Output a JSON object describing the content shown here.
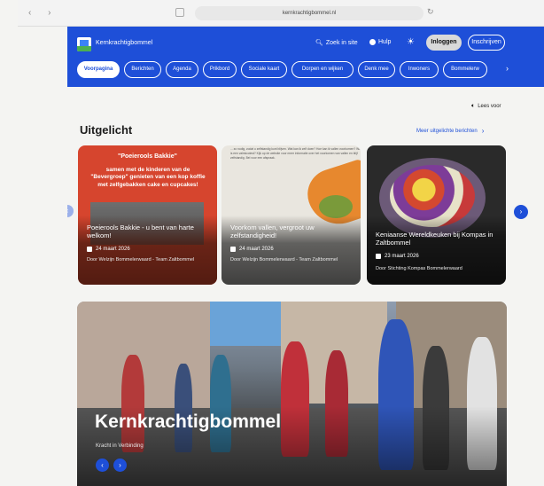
{
  "browser": {
    "nav_arrows": "‹ ›",
    "url": "kernkrachtigbommel.nl",
    "reload_icon": "↻"
  },
  "header": {
    "site_name": "Kernkrachtigbommel",
    "search_label": "Zoek in site",
    "help_label": "Hulp",
    "login_label": "Inloggen",
    "signup_label": "Inschrijven",
    "accent_color": "#1e4fd8"
  },
  "nav": {
    "items": [
      {
        "label": "Voorpagina",
        "active": true
      },
      {
        "label": "Berichten"
      },
      {
        "label": "Agenda"
      },
      {
        "label": "Prikbord"
      },
      {
        "label": "Sociale kaart"
      },
      {
        "label": "Dorpen en wijken"
      },
      {
        "label": "Denk mee"
      },
      {
        "label": "Inwoners"
      },
      {
        "label": "Bommelerw"
      }
    ],
    "next_icon": "›"
  },
  "main": {
    "read_aloud": "Lees voor",
    "section_title": "Uitgelicht",
    "more_link": "Meer uitgelichte berichten",
    "cards": [
      {
        "poster_heading": "\"Poeierools Bakkie\"",
        "poster_body": "samen met de kinderen van de \"Bevergroep\" genieten van een kop koffie met zelfgebakken cake en cupcakes!",
        "title": "Poeierools Bakkie - u bent van harte welkom!",
        "date": "24 maart 2026",
        "organization": "Door Welzijn Bommelerwaard - Team Zaltbommel"
      },
      {
        "poster_text": "... zo nodig, zodat u zelfstandig kunt blijven. Wat kan ik zelf doen? Hoe kan ik vallen voorkomen? Wat is een valrisicotest? Kijk op de website voor meer informatie over het voorkomen van vallen en blijf zelfstandig. Bel voor een afspraak.",
        "title": "Voorkom vallen, vergroot uw zelfstandigheid!",
        "date": "24 maart 2026",
        "organization": "Door Welzijn Bommelerwaard - Team Zaltbommel"
      },
      {
        "title": "Keniaanse Wereldkeuken bij Kompas in Zaltbommel",
        "date": "23 maart 2026",
        "organization": "Door Stichting Kompas Bommelerwaard"
      }
    ]
  },
  "hero": {
    "title": "Kernkrachtigbommel",
    "subtitle": "Kracht in Verbinding"
  }
}
